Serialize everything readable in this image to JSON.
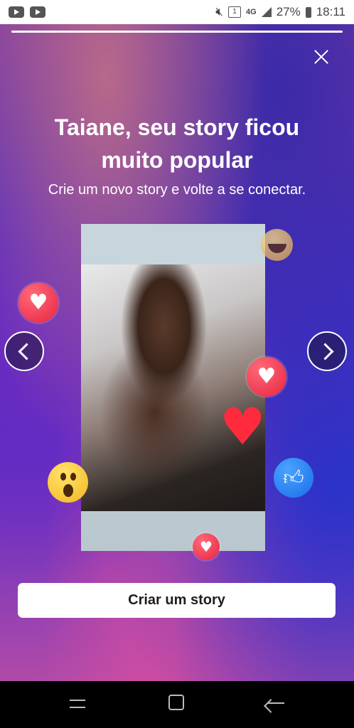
{
  "status_bar": {
    "network": "4G",
    "sim": "1",
    "battery": "27%",
    "time": "18:11"
  },
  "story": {
    "title": "Taiane, seu story ficou muito popular",
    "subtitle": "Crie um novo story e volte a se conectar.",
    "cta_label": "Criar um story",
    "progress": 1.0
  },
  "icons": {
    "close": "close-icon",
    "prev": "chevron-left-icon",
    "next": "chevron-right-icon",
    "reactions": [
      "heart-icon",
      "heart-icon",
      "heart-icon",
      "heart-icon",
      "like-icon",
      "wow-icon",
      "haha-icon"
    ]
  },
  "colors": {
    "heart": "#e8233f",
    "like": "#1a6ee8",
    "button_bg": "#ffffff",
    "button_text": "#1c1e21"
  }
}
